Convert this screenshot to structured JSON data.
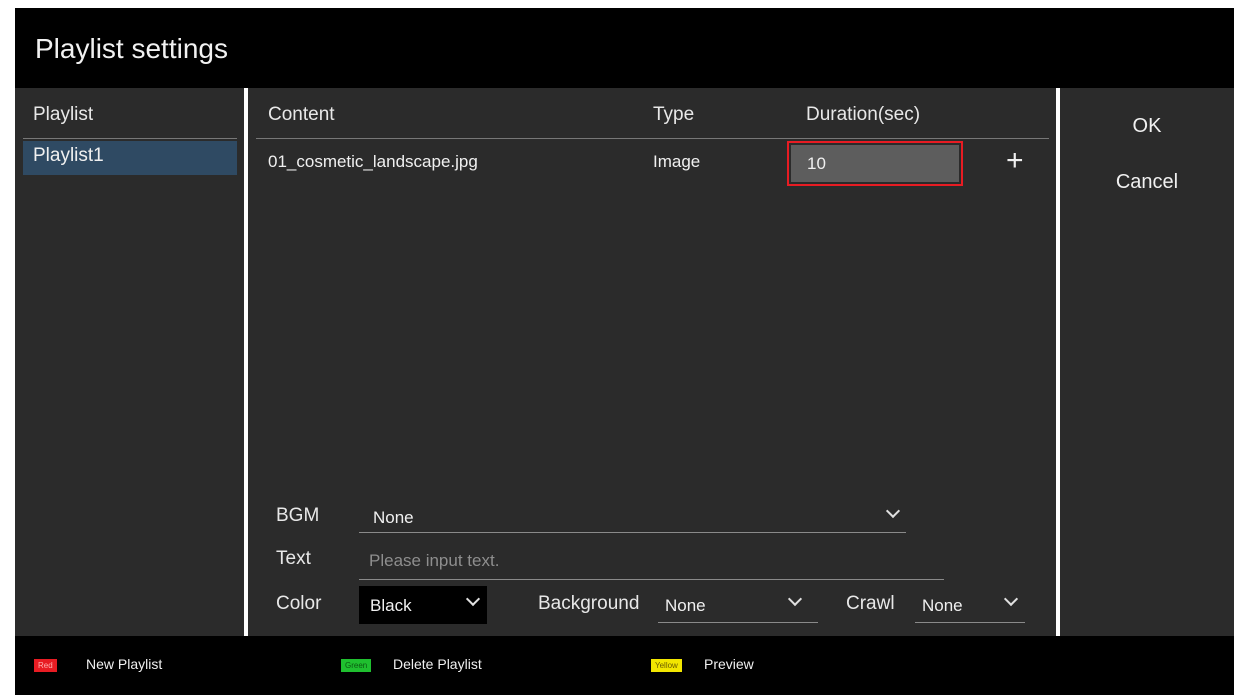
{
  "title": "Playlist settings",
  "playlist_panel": {
    "header": "Playlist",
    "items": [
      "Playlist1"
    ]
  },
  "content_panel": {
    "columns": {
      "content": "Content",
      "type": "Type",
      "duration": "Duration(sec)"
    },
    "rows": [
      {
        "content": "01_cosmetic_landscape.jpg",
        "type": "Image",
        "duration": "10"
      }
    ],
    "add_icon": "plus-icon"
  },
  "options": {
    "bgm": {
      "label": "BGM",
      "value": "None"
    },
    "text": {
      "label": "Text",
      "placeholder": "Please input text."
    },
    "color": {
      "label": "Color",
      "value": "Black"
    },
    "background": {
      "label": "Background",
      "value": "None"
    },
    "crawl": {
      "label": "Crawl",
      "value": "None"
    }
  },
  "actions": {
    "ok": "OK",
    "cancel": "Cancel"
  },
  "footer": {
    "keys": [
      {
        "key": "Red",
        "label": "New Playlist",
        "color": "#e81c23"
      },
      {
        "key": "Green",
        "label": "Delete Playlist",
        "color": "#1fbf2f"
      },
      {
        "key": "Yellow",
        "label": "Preview",
        "color": "#f2e600"
      }
    ]
  },
  "colors": {
    "panel": "#2b2b2b",
    "selection": "#2f4a63",
    "focus_border": "#e81c23"
  }
}
